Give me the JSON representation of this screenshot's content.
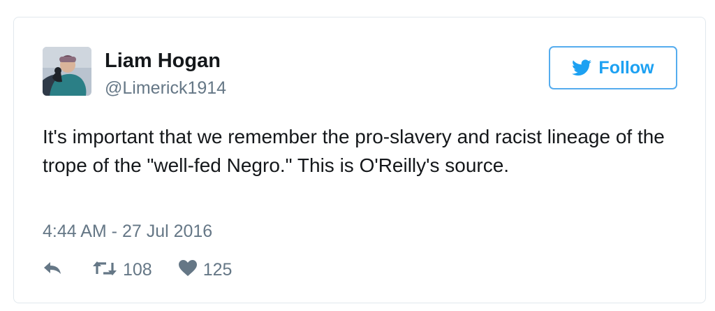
{
  "author": {
    "name": "Liam Hogan",
    "handle": "@Limerick1914",
    "avatar_icon": "profile-photo"
  },
  "follow_button": {
    "label": "Follow",
    "icon": "twitter-bird-icon",
    "color": "#55acee"
  },
  "tweet": {
    "text": "It's important that we remember the pro-slavery and racist lineage of the trope of the \"well-fed Negro.\" This is O'Reilly's source.",
    "timestamp": "4:44 AM - 27 Jul 2016"
  },
  "actions": {
    "reply_icon": "reply-icon",
    "retweet_icon": "retweet-icon",
    "retweet_count": "108",
    "like_icon": "heart-icon",
    "like_count": "125"
  },
  "colors": {
    "text_primary": "#14171a",
    "text_secondary": "#657786",
    "accent": "#1da1f2",
    "border": "#e1e8ed"
  }
}
